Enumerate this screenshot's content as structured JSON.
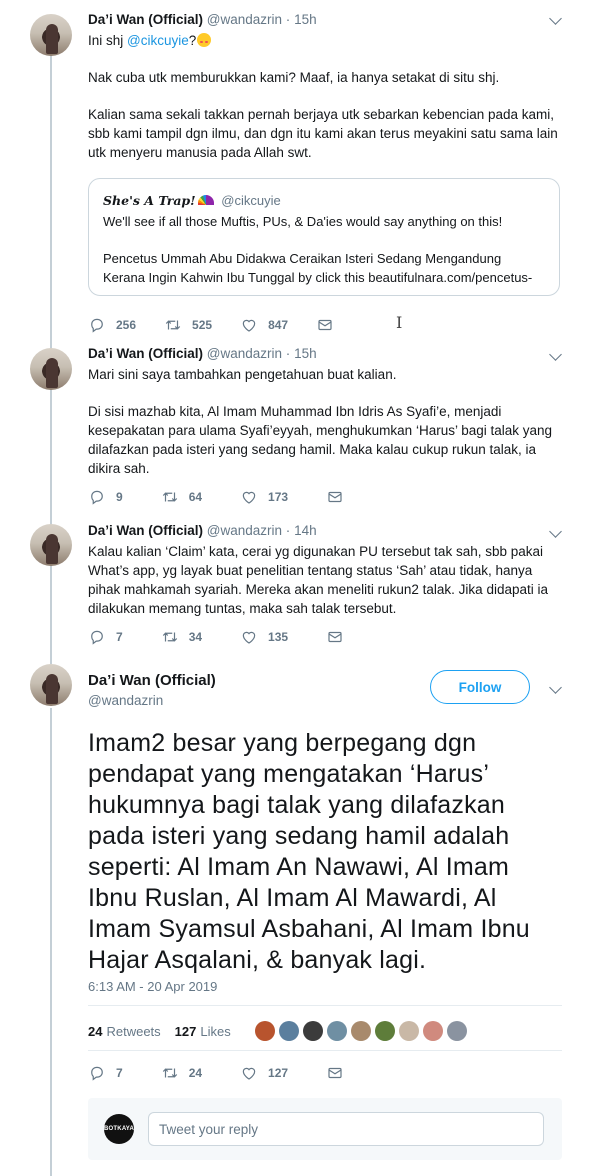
{
  "tweets": [
    {
      "name": "Da’i Wan (Official)",
      "handle": "@wandazrin",
      "time": "15h",
      "line1_prefix": "Ini shj ",
      "line1_mention": "@cikcuyie",
      "line1_suffix": "?",
      "paragraphs": [
        "Nak cuba utk memburukkan kami? Maaf, ia hanya setakat di situ shj.",
        "Kalian sama sekali takkan pernah berjaya utk sebarkan kebencian pada kami, sbb kami tampil dgn ilmu, dan dgn itu kami akan terus meyakini satu sama lain utk menyeru manusia pada Allah swt."
      ],
      "quote": {
        "name": "She's A Trap!",
        "handle": "@cikcuyie",
        "line1": "We'll see if all those Muftis, PUs, & Da'ies would say anything on this!",
        "line2": "Pencetus Ummah Abu Didakwa Ceraikan Isteri Sedang Mengandung Kerana Ingin Kahwin Ibu Tunggal by click this beautifulnara.com/pencetus-"
      },
      "replies": "256",
      "retweets": "525",
      "likes": "847"
    },
    {
      "name": "Da’i Wan (Official)",
      "handle": "@wandazrin",
      "time": "15h",
      "paragraphs": [
        "Mari sini saya tambahkan pengetahuan buat kalian.",
        "Di sisi mazhab kita, Al Imam Muhammad Ibn Idris As Syafi’e, menjadi kesepakatan para ulama Syafi’eyyah, menghukumkan ‘Harus’ bagi talak yang dilafazkan pada isteri yang sedang hamil. Maka kalau cukup rukun talak, ia dikira sah."
      ],
      "replies": "9",
      "retweets": "64",
      "likes": "173"
    },
    {
      "name": "Da’i Wan (Official)",
      "handle": "@wandazrin",
      "time": "14h",
      "paragraphs": [
        "Kalau kalian ‘Claim’ kata, cerai yg digunakan PU tersebut tak sah, sbb pakai What’s app, yg layak buat penelitian tentang status ‘Sah’ atau tidak, hanya pihak mahkamah syariah. Mereka akan meneliti rukun2 talak. Jika didapati ia dilakukan memang tuntas, maka sah talak tersebut."
      ],
      "replies": "7",
      "retweets": "34",
      "likes": "135"
    }
  ],
  "main_tweet": {
    "name": "Da’i Wan (Official)",
    "handle": "@wandazrin",
    "follow_label": "Follow",
    "text": "Imam2 besar yang berpegang dgn pendapat yang mengatakan ‘Harus’ hukumnya bagi talak yang dilafazkan pada isteri yang sedang hamil adalah seperti: Al Imam An Nawawi, Al Imam Ibnu Ruslan, Al Imam Al Mawardi, Al Imam Syamsul Asbahani, Al Imam Ibnu Hajar Asqalani, & banyak lagi.",
    "timestamp": "6:13 AM - 20 Apr 2019",
    "retweets_count": "24",
    "retweets_label": "Retweets",
    "likes_count": "127",
    "likes_label": "Likes",
    "replies": "7",
    "retweets": "24",
    "likes": "127"
  },
  "reply_box": {
    "avatar_text": "BOTKAYA",
    "placeholder": "Tweet your reply"
  },
  "colors": {
    "accent": "#1da1f2",
    "mention": "#1b95e0",
    "secondary_text": "#657786",
    "thread_line": "#c4cfd6"
  }
}
